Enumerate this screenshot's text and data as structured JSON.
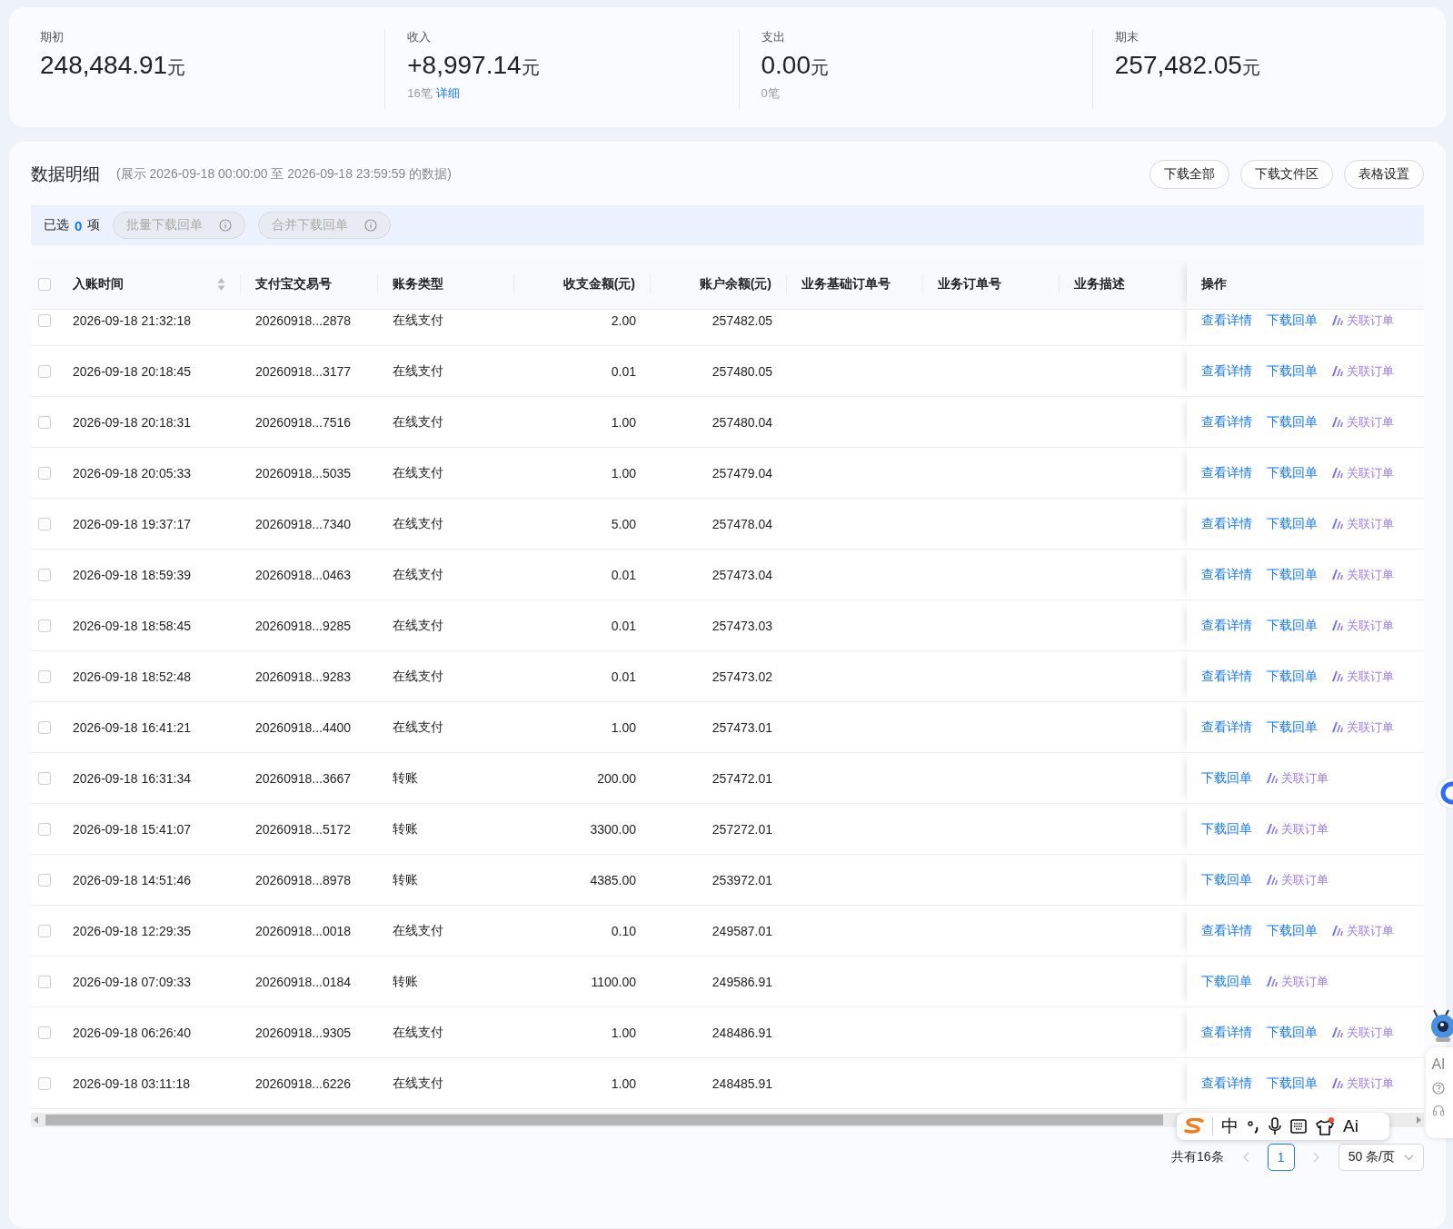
{
  "summary": [
    {
      "label": "期初",
      "amount": "248,484.91",
      "unit": "元"
    },
    {
      "label": "收入",
      "amount": "+8,997.14",
      "unit": "元",
      "count": "16笔",
      "link": "详细"
    },
    {
      "label": "支出",
      "amount": "0.00",
      "unit": "元",
      "count": "0笔"
    },
    {
      "label": "期末",
      "amount": "257,482.05",
      "unit": "元"
    }
  ],
  "details": {
    "title": "数据明细",
    "range_note": "(展示 2026-09-18 00:00:00 至 2026-09-18 23:59:59 的数据)",
    "buttons": [
      "下载全部",
      "下载文件区",
      "表格设置"
    ],
    "selection": {
      "prefix": "已选",
      "count": "0",
      "suffix": "项",
      "buttons": [
        {
          "label": "批量下载回单",
          "disabled": true
        },
        {
          "label": "合并下载回单",
          "disabled": true
        }
      ]
    }
  },
  "table": {
    "header_checked": false,
    "columns": [
      {
        "label": "入账时间",
        "sortable": true
      },
      {
        "label": "支付宝交易号",
        "sortable": false
      },
      {
        "label": "账务类型",
        "sortable": false
      },
      {
        "label": "收支金额(元)",
        "sortable": false
      },
      {
        "label": "账户余额(元)",
        "sortable": false
      },
      {
        "label": "业务基础订单号",
        "sortable": false
      },
      {
        "label": "业务订单号",
        "sortable": false
      },
      {
        "label": "业务描述",
        "sortable": false
      },
      {
        "label": "操作",
        "sortable": false
      }
    ],
    "rows": [
      {
        "checked": false,
        "time": "2026-09-18 21:32:18",
        "trade_no": "20260918...2878",
        "type": "在线支付",
        "amount": "2.00",
        "balance": "257482.05",
        "actions": [
          {
            "label": "查看详情",
            "kind": "link"
          },
          {
            "label": "下载回单",
            "kind": "link"
          },
          {
            "label": "关联订单",
            "kind": "ai-link"
          }
        ]
      },
      {
        "checked": false,
        "time": "2026-09-18 20:18:45",
        "trade_no": "20260918...3177",
        "type": "在线支付",
        "amount": "0.01",
        "balance": "257480.05",
        "actions": [
          {
            "label": "查看详情",
            "kind": "link"
          },
          {
            "label": "下载回单",
            "kind": "link"
          },
          {
            "label": "关联订单",
            "kind": "ai-link"
          }
        ]
      },
      {
        "checked": false,
        "time": "2026-09-18 20:18:31",
        "trade_no": "20260918...7516",
        "type": "在线支付",
        "amount": "1.00",
        "balance": "257480.04",
        "actions": [
          {
            "label": "查看详情",
            "kind": "link"
          },
          {
            "label": "下载回单",
            "kind": "link"
          },
          {
            "label": "关联订单",
            "kind": "ai-link"
          }
        ]
      },
      {
        "checked": false,
        "time": "2026-09-18 20:05:33",
        "trade_no": "20260918...5035",
        "type": "在线支付",
        "amount": "1.00",
        "balance": "257479.04",
        "actions": [
          {
            "label": "查看详情",
            "kind": "link"
          },
          {
            "label": "下载回单",
            "kind": "link"
          },
          {
            "label": "关联订单",
            "kind": "ai-link"
          }
        ]
      },
      {
        "checked": false,
        "time": "2026-09-18 19:37:17",
        "trade_no": "20260918...7340",
        "type": "在线支付",
        "amount": "5.00",
        "balance": "257478.04",
        "actions": [
          {
            "label": "查看详情",
            "kind": "link"
          },
          {
            "label": "下载回单",
            "kind": "link"
          },
          {
            "label": "关联订单",
            "kind": "ai-link"
          }
        ]
      },
      {
        "checked": false,
        "time": "2026-09-18 18:59:39",
        "trade_no": "20260918...0463",
        "type": "在线支付",
        "amount": "0.01",
        "balance": "257473.04",
        "actions": [
          {
            "label": "查看详情",
            "kind": "link"
          },
          {
            "label": "下载回单",
            "kind": "link"
          },
          {
            "label": "关联订单",
            "kind": "ai-link"
          }
        ]
      },
      {
        "checked": false,
        "time": "2026-09-18 18:58:45",
        "trade_no": "20260918...9285",
        "type": "在线支付",
        "amount": "0.01",
        "balance": "257473.03",
        "actions": [
          {
            "label": "查看详情",
            "kind": "link"
          },
          {
            "label": "下载回单",
            "kind": "link"
          },
          {
            "label": "关联订单",
            "kind": "ai-link"
          }
        ]
      },
      {
        "checked": false,
        "time": "2026-09-18 18:52:48",
        "trade_no": "20260918...9283",
        "type": "在线支付",
        "amount": "0.01",
        "balance": "257473.02",
        "actions": [
          {
            "label": "查看详情",
            "kind": "link"
          },
          {
            "label": "下载回单",
            "kind": "link"
          },
          {
            "label": "关联订单",
            "kind": "ai-link"
          }
        ]
      },
      {
        "checked": false,
        "time": "2026-09-18 16:41:21",
        "trade_no": "20260918...4400",
        "type": "在线支付",
        "amount": "1.00",
        "balance": "257473.01",
        "actions": [
          {
            "label": "查看详情",
            "kind": "link"
          },
          {
            "label": "下载回单",
            "kind": "link"
          },
          {
            "label": "关联订单",
            "kind": "ai-link"
          }
        ]
      },
      {
        "checked": false,
        "time": "2026-09-18 16:31:34",
        "trade_no": "20260918...3667",
        "type": "转账",
        "amount": "200.00",
        "balance": "257472.01",
        "actions": [
          {
            "label": "下载回单",
            "kind": "link"
          },
          {
            "label": "关联订单",
            "kind": "ai-link"
          }
        ]
      },
      {
        "checked": false,
        "time": "2026-09-18 15:41:07",
        "trade_no": "20260918...5172",
        "type": "转账",
        "amount": "3300.00",
        "balance": "257272.01",
        "actions": [
          {
            "label": "下载回单",
            "kind": "link"
          },
          {
            "label": "关联订单",
            "kind": "ai-link"
          }
        ]
      },
      {
        "checked": false,
        "time": "2026-09-18 14:51:46",
        "trade_no": "20260918...8978",
        "type": "转账",
        "amount": "4385.00",
        "balance": "253972.01",
        "actions": [
          {
            "label": "下载回单",
            "kind": "link"
          },
          {
            "label": "关联订单",
            "kind": "ai-link"
          }
        ]
      },
      {
        "checked": false,
        "time": "2026-09-18 12:29:35",
        "trade_no": "20260918...0018",
        "type": "在线支付",
        "amount": "0.10",
        "balance": "249587.01",
        "actions": [
          {
            "label": "查看详情",
            "kind": "link"
          },
          {
            "label": "下载回单",
            "kind": "link"
          },
          {
            "label": "关联订单",
            "kind": "ai-link"
          }
        ]
      },
      {
        "checked": false,
        "time": "2026-09-18 07:09:33",
        "trade_no": "20260918...0184",
        "type": "转账",
        "amount": "1100.00",
        "balance": "249586.91",
        "actions": [
          {
            "label": "下载回单",
            "kind": "link"
          },
          {
            "label": "关联订单",
            "kind": "ai-link"
          }
        ]
      },
      {
        "checked": false,
        "time": "2026-09-18 06:26:40",
        "trade_no": "20260918...9305",
        "type": "在线支付",
        "amount": "1.00",
        "balance": "248486.91",
        "actions": [
          {
            "label": "查看详情",
            "kind": "link"
          },
          {
            "label": "下载回单",
            "kind": "link"
          },
          {
            "label": "关联订单",
            "kind": "ai-link"
          }
        ]
      },
      {
        "checked": false,
        "time": "2026-09-18 03:11:18",
        "trade_no": "20260918...6226",
        "type": "在线支付",
        "amount": "1.00",
        "balance": "248485.91",
        "actions": [
          {
            "label": "查看详情",
            "kind": "link"
          },
          {
            "label": "下载回单",
            "kind": "link"
          },
          {
            "label": "关联订单",
            "kind": "ai-link"
          }
        ]
      }
    ]
  },
  "pagination": {
    "total": "共有16条",
    "prev_disabled": true,
    "next_disabled": true,
    "pages": [
      {
        "label": "1",
        "selected": true
      }
    ],
    "page_size": "50 条/页"
  },
  "ime_toolbar": {
    "mode_label": "中",
    "ai_label": "Ai"
  },
  "side_rail": {
    "ai_label": "AI"
  }
}
